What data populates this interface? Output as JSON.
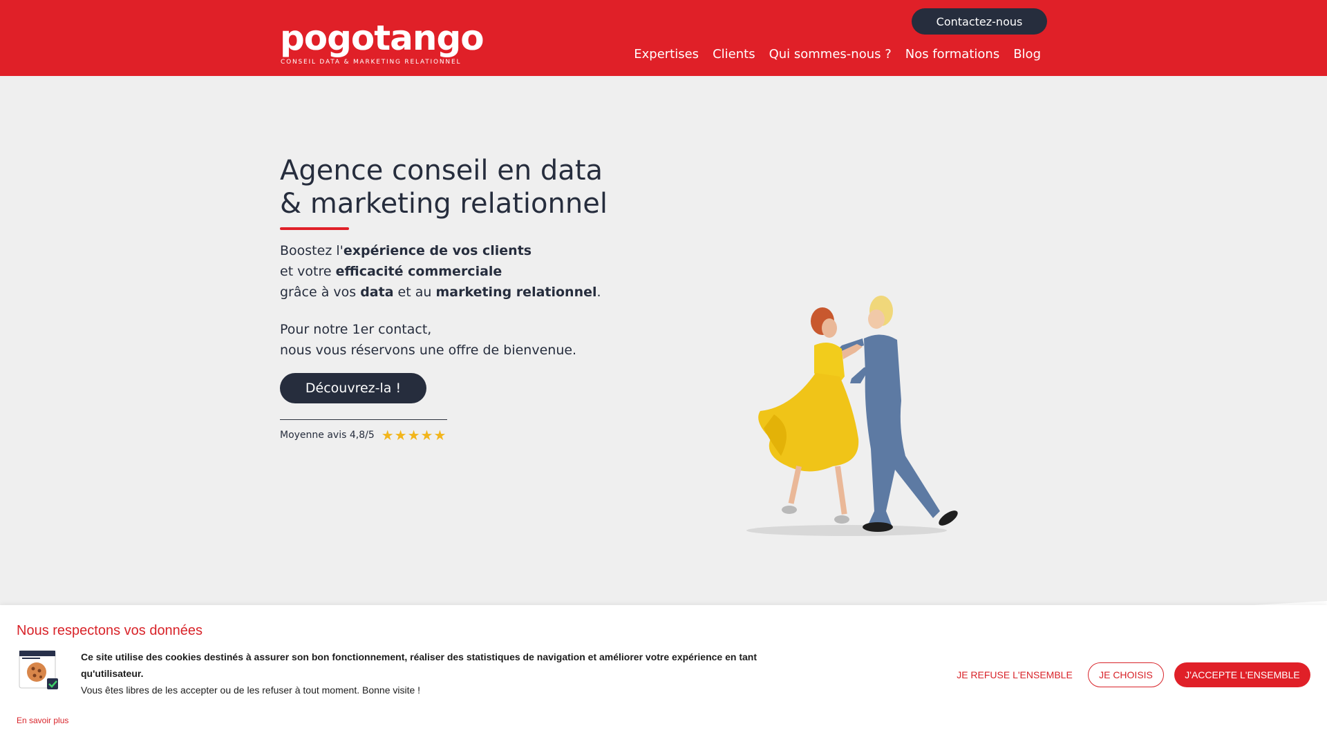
{
  "header": {
    "logo": {
      "wordmark": "pogotango",
      "tagline": "CONSEIL DATA & MARKETING RELATIONNEL"
    },
    "contact_button": "Contactez-nous",
    "nav": [
      {
        "label": "Expertises"
      },
      {
        "label": "Clients"
      },
      {
        "label": "Qui sommes-nous ?"
      },
      {
        "label": "Nos formations"
      },
      {
        "label": "Blog"
      }
    ]
  },
  "hero": {
    "title_line1": "Agence conseil en data",
    "title_line2": "& marketing relationnel",
    "text": {
      "l1_a": "Boostez l'",
      "l1_b": "expérience de vos clients",
      "l2_a": "et votre ",
      "l2_b": "efficacité commerciale",
      "l3_a": "grâce à vos ",
      "l3_b": "data",
      "l3_c": " et au ",
      "l3_d": "marketing relationnel",
      "l3_e": "."
    },
    "offer_line1": "Pour notre 1er contact,",
    "offer_line2": "nous vous réservons une offre de bienvenue.",
    "cta": "Découvrez-la !",
    "rating": {
      "label": "Moyenne avis 4,8/5",
      "stars": "★★★★★",
      "value": 4.8,
      "max": 5
    }
  },
  "cookie_banner": {
    "title": "Nous respectons vos données",
    "text_bold": "Ce site utilise des cookies destinés à assurer son bon fonctionnement, réaliser des statistiques de navigation et améliorer votre expérience en tant qu'utilisateur.",
    "text_normal": "Vous êtes libres de les accepter ou de les refuser à tout moment.  Bonne visite !",
    "learn_more": "En savoir plus",
    "refuse_button": "JE REFUSE L'ENSEMBLE",
    "choose_button": "JE CHOISIS",
    "accept_button": "J'ACCEPTE L'ENSEMBLE"
  },
  "colors": {
    "brand_red": "#e02028",
    "dark_navy": "#262d3d",
    "hero_background": "#efefef",
    "star_gold": "#f2b51c"
  },
  "icons": [
    "cookie-shield-icon",
    "star-icon"
  ]
}
